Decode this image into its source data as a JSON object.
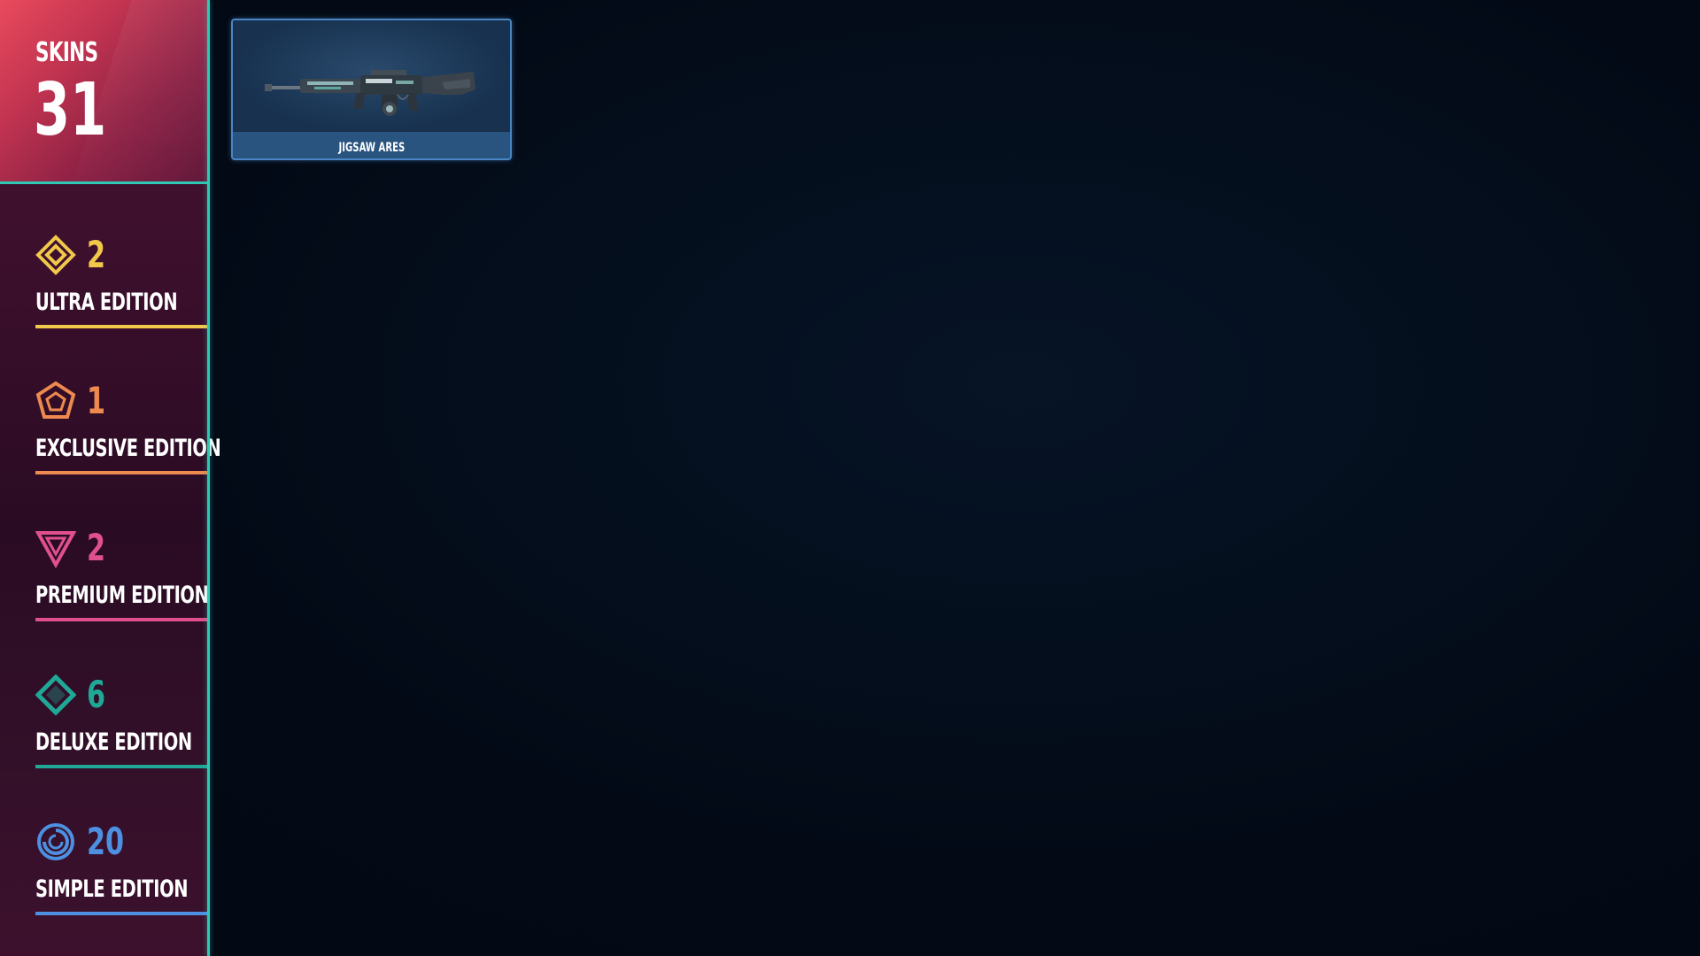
{
  "summary": {
    "label": "SKINS",
    "count": "31"
  },
  "editions": [
    {
      "count": "2",
      "name": "ULTRA EDITION",
      "color": "#f2c84b",
      "icon": "ultra-diamond-icon"
    },
    {
      "count": "1",
      "name": "EXCLUSIVE EDITION",
      "color": "#ee8a4f",
      "icon": "exclusive-pentagon-icon"
    },
    {
      "count": "2",
      "name": "PREMIUM EDITION",
      "color": "#e0508f",
      "icon": "premium-triangle-icon"
    },
    {
      "count": "6",
      "name": "DELUXE EDITION",
      "color": "#1fa896",
      "icon": "deluxe-diamond-icon"
    },
    {
      "count": "20",
      "name": "SIMPLE EDITION",
      "color": "#4d8fe0",
      "icon": "simple-swirl-icon"
    }
  ],
  "skins": [
    {
      "name": "JIGSAW ARES",
      "icon": "rifle-icon"
    }
  ],
  "colors": {
    "accent": "#2ec8b4",
    "card_border": "#4a86c4",
    "background": "#030b17"
  }
}
